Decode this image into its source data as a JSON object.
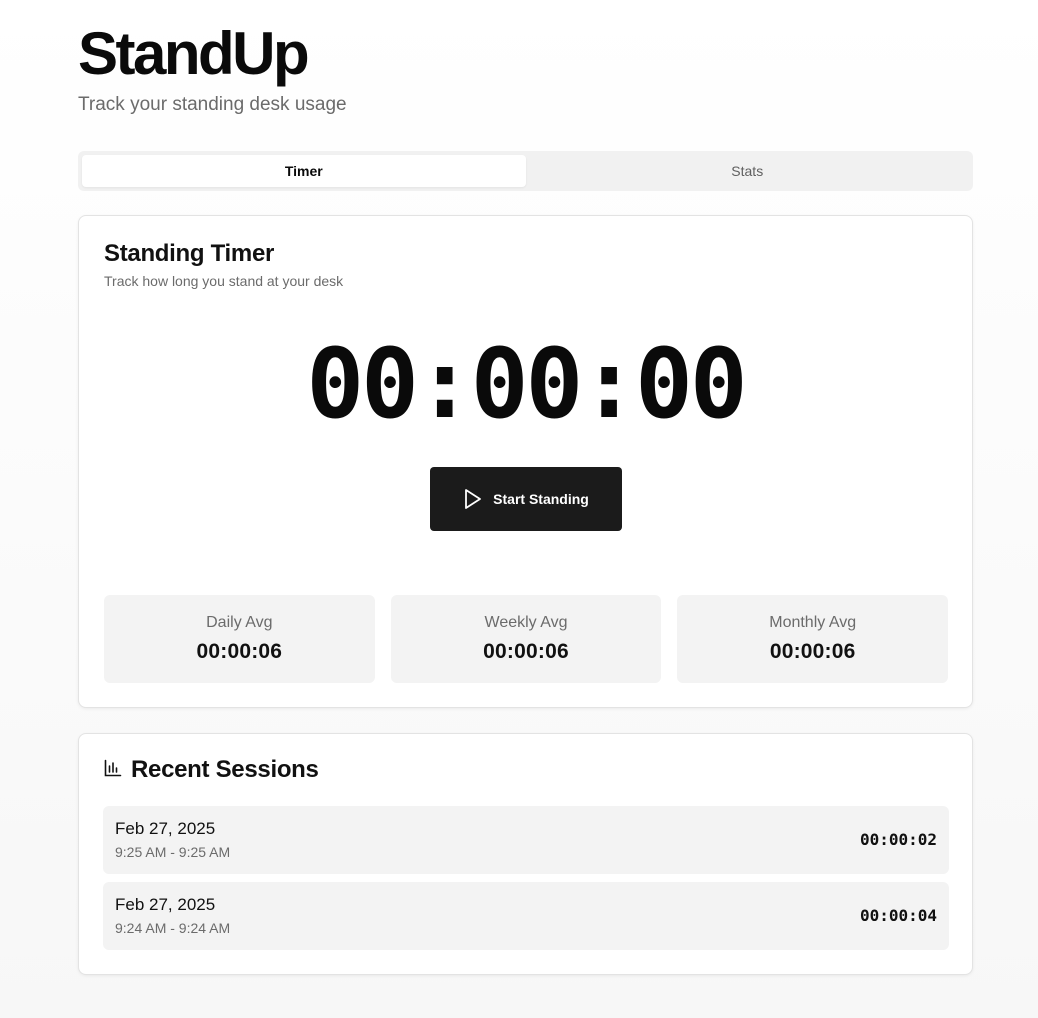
{
  "header": {
    "title": "StandUp",
    "subtitle": "Track your standing desk usage"
  },
  "tabs": [
    {
      "label": "Timer",
      "active": true
    },
    {
      "label": "Stats",
      "active": false
    }
  ],
  "timer": {
    "title": "Standing Timer",
    "description": "Track how long you stand at your desk",
    "display": "00:00:00",
    "start_button_label": "Start Standing",
    "start_icon": "play-icon"
  },
  "averages": [
    {
      "label": "Daily Avg",
      "value": "00:00:06"
    },
    {
      "label": "Weekly Avg",
      "value": "00:00:06"
    },
    {
      "label": "Monthly Avg",
      "value": "00:00:06"
    }
  ],
  "sessions": {
    "title": "Recent Sessions",
    "icon": "bar-chart-icon",
    "items": [
      {
        "date": "Feb 27, 2025",
        "range": "9:25 AM - 9:25 AM",
        "duration": "00:00:02"
      },
      {
        "date": "Feb 27, 2025",
        "range": "9:24 AM - 9:24 AM",
        "duration": "00:00:04"
      }
    ]
  },
  "colors": {
    "primary_button": "#1b1b1b",
    "panel_background": "#f3f3f3",
    "muted_text": "#6b6b6b"
  }
}
